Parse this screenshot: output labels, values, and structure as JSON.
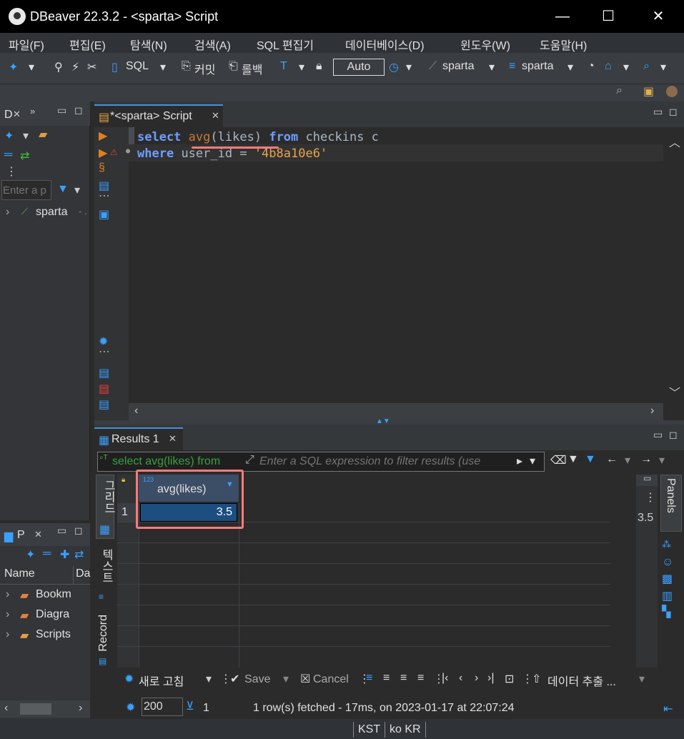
{
  "window": {
    "title": "DBeaver 22.3.2 - <sparta> Script",
    "minimize": "—",
    "maximize": "☐",
    "close": "✕"
  },
  "menu": [
    "파일(F)",
    "편집(E)",
    "탐색(N)",
    "검색(A)",
    "SQL 편집기",
    "데이터베이스(D)",
    "윈도우(W)",
    "도움말(H)"
  ],
  "toolbar": {
    "sql_label": "SQL",
    "commit_label": "커밋",
    "rollback_label": "롤백",
    "auto_label": "Auto",
    "datasource": "sparta",
    "schema": "sparta"
  },
  "left_panel": {
    "tab_label": "D",
    "filter_placeholder": "Enter a p",
    "tree_item": "sparta",
    "tree_item_suffix": "- ."
  },
  "projects_panel": {
    "tab_label": "P",
    "col_name": "Name",
    "col_da": "Da",
    "items": [
      "Bookm",
      "Diagra",
      "Scripts"
    ]
  },
  "editor": {
    "tab_label": "*<sparta> Script",
    "line1": {
      "select": "select",
      "avg": "avg",
      "paren_open": "(",
      "likes": "likes",
      "paren_close": ")",
      "from": "from",
      "rest": "checkins c"
    },
    "line2": {
      "where": "where",
      "mid": "user_id =",
      "value": "'4b8a10e6'"
    }
  },
  "results": {
    "tab_label": "Results 1",
    "query_preview": "select avg(likes) from",
    "filter_placeholder": "Enter a SQL expression to filter results (use",
    "column_header": "avg(likes)",
    "column_type_badge": "123",
    "row_number": "1",
    "cell_value": "3.5",
    "side_value": "3.5",
    "vtab_grid": "그리드",
    "vtab_text": "텍스트",
    "vtab_record": "Record",
    "panels_label": "Panels",
    "refresh_label": "새로 고침",
    "save_label": "Save",
    "cancel_label": "Cancel",
    "export_label": "데이터 추출 ...",
    "fetch_size": "200",
    "row_count": "1",
    "status_message": "1 row(s) fetched - 17ms, on 2023-01-17 at 22:07:24"
  },
  "statusbar": {
    "timezone": "KST",
    "locale": "ko  KR"
  }
}
